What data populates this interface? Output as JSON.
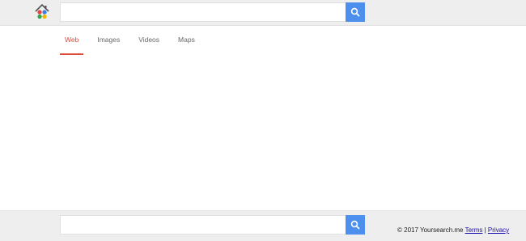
{
  "header": {
    "logo_icon": "house-logo-icon",
    "search": {
      "value": "",
      "placeholder": "",
      "button_icon": "search-icon"
    }
  },
  "tabs": [
    {
      "label": "Web",
      "active": true
    },
    {
      "label": "Images",
      "active": false
    },
    {
      "label": "Videos",
      "active": false
    },
    {
      "label": "Maps",
      "active": false
    }
  ],
  "footer": {
    "search": {
      "value": "",
      "placeholder": "",
      "button_icon": "search-icon"
    },
    "copyright": "© 2017 Yoursearch.me",
    "terms_label": "Terms",
    "separator": "|",
    "privacy_label": "Privacy"
  },
  "colors": {
    "accent_blue": "#4d8fec",
    "active_tab_red": "#dd4b39",
    "bar_background": "#eeeeee"
  }
}
